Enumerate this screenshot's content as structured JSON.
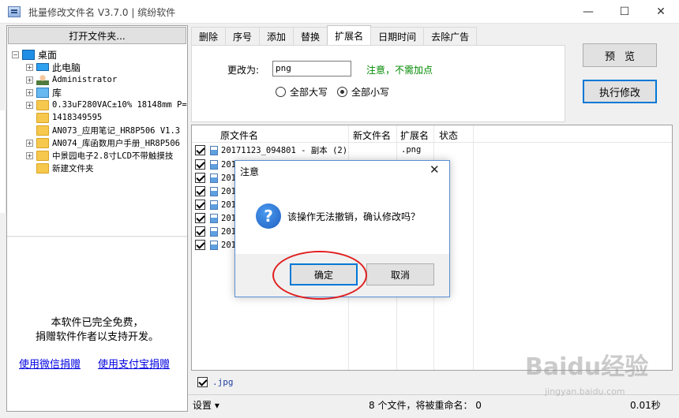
{
  "window": {
    "title": "批量修改文件名 V3.7.0 | 缤纷软件",
    "min_glyph": "—",
    "max_glyph": "☐",
    "close_glyph": "✕"
  },
  "left": {
    "open_button": "打开文件夹...",
    "tree": [
      {
        "label": "桌面",
        "icon": "desktop-icon",
        "expander": "−"
      },
      {
        "label": "此电脑",
        "icon": "computer-icon",
        "expander": "+"
      },
      {
        "label": "Administrator",
        "icon": "user-icon",
        "expander": "+"
      },
      {
        "label": "库",
        "icon": "library-icon",
        "expander": "+"
      },
      {
        "label": "0.33uF280VAC±10% 18148mm P=",
        "icon": "folder-icon",
        "expander": "+"
      },
      {
        "label": "1418349595",
        "icon": "folder-icon",
        "expander": ""
      },
      {
        "label": "AN073_应用笔记_HR8P506 V1.3",
        "icon": "folder-icon",
        "expander": ""
      },
      {
        "label": "AN074_库函数用户手册_HR8P506",
        "icon": "folder-icon",
        "expander": "+"
      },
      {
        "label": "中景园电子2.8寸LCD不带触摸技",
        "icon": "folder-icon",
        "expander": "+"
      },
      {
        "label": "新建文件夹",
        "icon": "folder-icon",
        "expander": ""
      }
    ],
    "free_line1": "本软件已完全免费，",
    "free_line2": "捐赠软件作者以支持开发。",
    "donate_wechat": "使用微信捐赠",
    "donate_alipay": "使用支付宝捐赠"
  },
  "tabs": [
    "删除",
    "序号",
    "添加",
    "替换",
    "扩展名",
    "日期时间",
    "去除广告"
  ],
  "active_tab": 4,
  "ext_panel": {
    "change_label": "更改为:",
    "value": "png",
    "hint": "注意，不需加点",
    "upper": "全部大写",
    "lower": "全部小写",
    "lower_selected": true
  },
  "buttons": {
    "preview": "预览",
    "execute": "执行修改"
  },
  "grid": {
    "headers": [
      "原文件名",
      "新文件名",
      "扩展名",
      "状态"
    ],
    "rows": [
      {
        "name": "20171123_094801 - 副本 (2)",
        "ext": ".png"
      },
      {
        "name": "201"
      },
      {
        "name": "201"
      },
      {
        "name": "201"
      },
      {
        "name": "201"
      },
      {
        "name": "201"
      },
      {
        "name": "201"
      },
      {
        "name": "201"
      }
    ]
  },
  "filter": {
    "label": ".jpg",
    "checked": true
  },
  "status": {
    "settings": "设置 ▾",
    "count": "8 个文件，将被重命名：  0",
    "time": "0.01秒"
  },
  "dialog": {
    "title": "注意",
    "message": "该操作无法撤销，确认修改吗？",
    "ok": "确定",
    "cancel": "取消",
    "icon_glyph": "?"
  },
  "watermark": {
    "main": "Baidu经验",
    "sub": "jingyan.baidu.com"
  },
  "colors": {
    "accent": "#0078d7",
    "hint_green": "#008a00",
    "link_blue": "#0000e0",
    "annotation_red": "#e02020"
  }
}
